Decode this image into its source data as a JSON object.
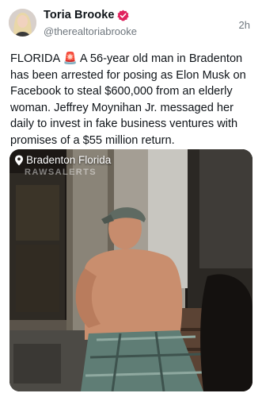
{
  "author": {
    "name": "Toria Brooke",
    "handle": "@therealtoriabrooke",
    "verified_color": "#e0245e"
  },
  "post": {
    "timestamp": "2h",
    "text": "FLORIDA 🚨 A 56-year old man in Bradenton has been arrested for posing as Elon Musk on Facebook to steal $600,000 from an elderly woman. Jeffrey Moynihan Jr. messaged her daily to invest in fake business ventures with promises of a $55 million return."
  },
  "media": {
    "location_label": "Bradenton Florida",
    "location_icon": "map-pin-icon",
    "watermark": "RAWSALERTS"
  }
}
